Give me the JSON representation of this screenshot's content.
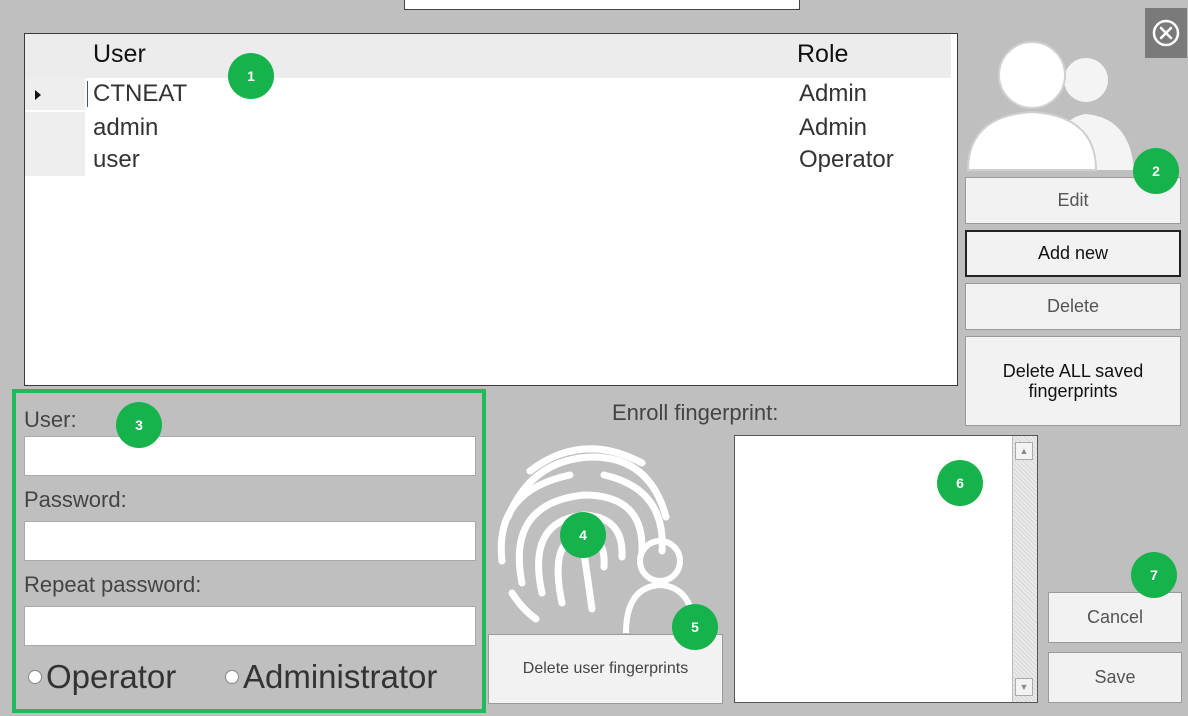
{
  "table": {
    "headers": {
      "user": "User",
      "role": "Role"
    },
    "rows": [
      {
        "user": "CTNEAT",
        "role": "Admin",
        "selected": true
      },
      {
        "user": "admin",
        "role": "Admin",
        "selected": false
      },
      {
        "user": "user",
        "role": "Operator",
        "selected": false
      }
    ]
  },
  "actions": {
    "edit": "Edit",
    "add_new": "Add new",
    "delete": "Delete",
    "delete_all_line1": "Delete ALL saved",
    "delete_all_line2": "fingerprints"
  },
  "form": {
    "user_label": "User:",
    "user_value": "",
    "password_label": "Password:",
    "password_value": "",
    "repeat_password_label": "Repeat password:",
    "repeat_password_value": "",
    "role_operator": "Operator",
    "role_administrator": "Administrator"
  },
  "fingerprint": {
    "enroll_label": "Enroll fingerprint:",
    "delete_user_fingerprints": "Delete user fingerprints"
  },
  "footer": {
    "cancel": "Cancel",
    "save": "Save"
  },
  "markers": [
    "1",
    "2",
    "3",
    "4",
    "5",
    "6",
    "7"
  ],
  "icons": [
    "close-icon",
    "users-icon",
    "fingerprint-user-icon",
    "selected-row-arrow-icon"
  ],
  "colors": {
    "marker": "#16b24b",
    "highlight_border": "#1fba5a",
    "background": "#bfbfbf"
  }
}
